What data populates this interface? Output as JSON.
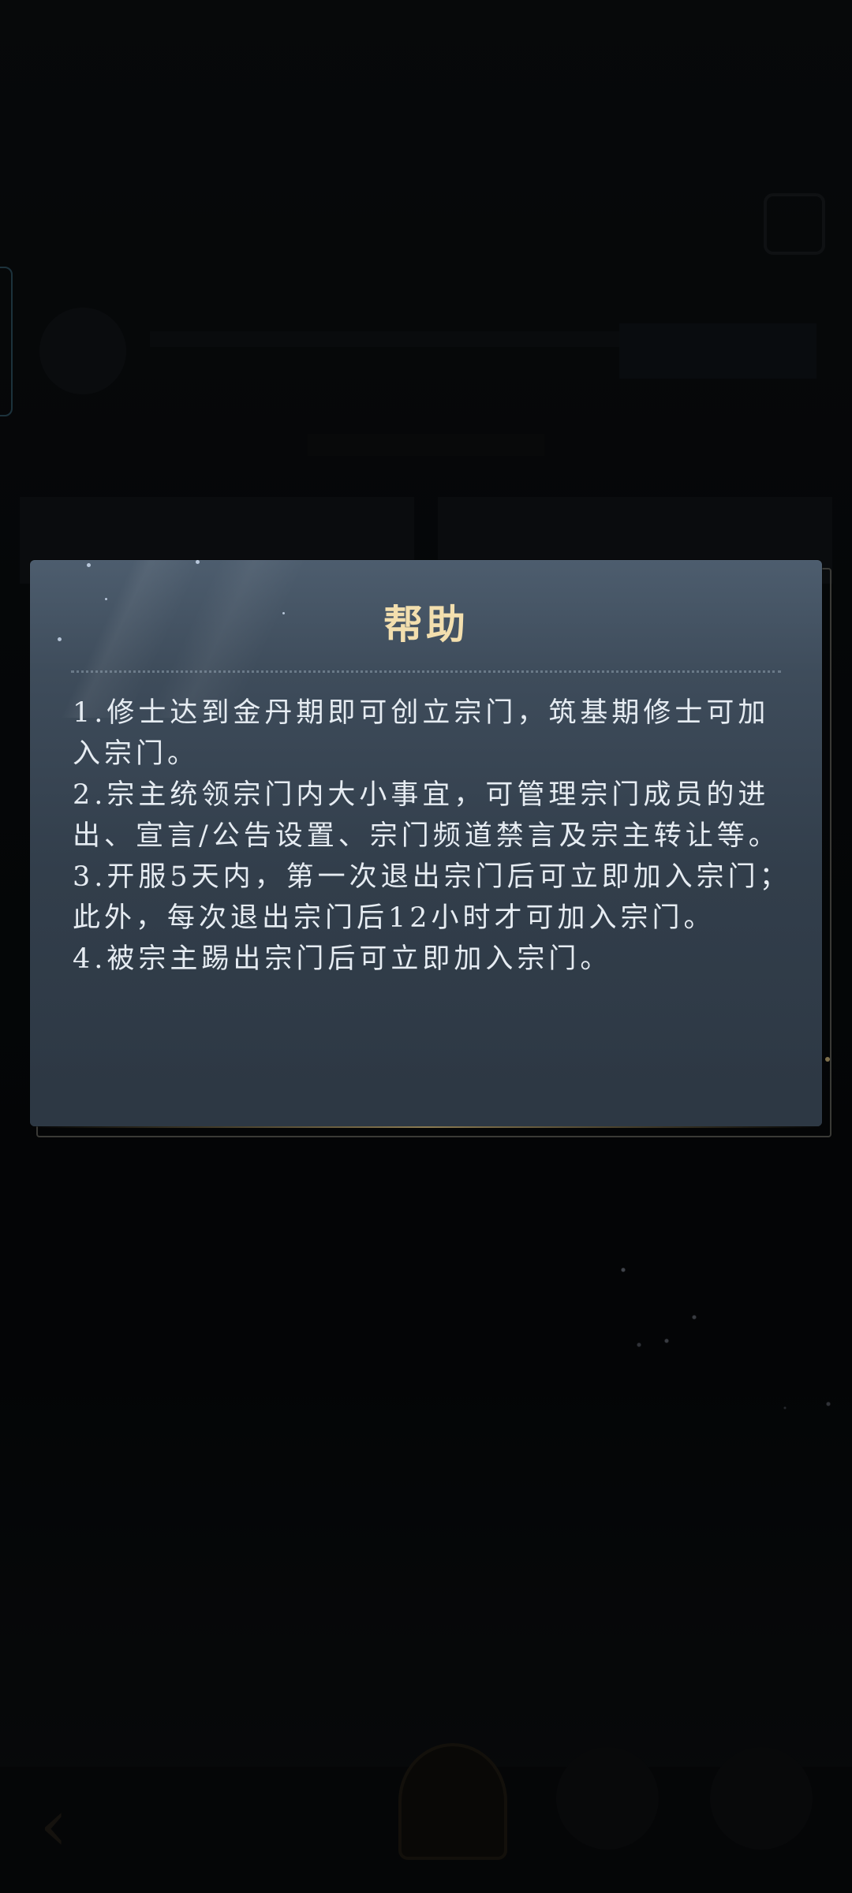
{
  "dialog": {
    "title": "帮助",
    "paragraphs": [
      "1.修士达到金丹期即可创立宗门，筑基期修士可加入宗门。",
      "2.宗主统领宗门内大小事宜，可管理宗门成员的进出、宣言/公告设置、宗门频道禁言及宗主转让等。",
      "3.开服5天内，第一次退出宗门后可立即加入宗门；此外，每次退出宗门后12小时才可加入宗门。",
      "4.被宗主踢出宗门后可立即加入宗门。"
    ]
  },
  "colors": {
    "title": "#f3dfae",
    "body_text": "#e6ecf2",
    "dialog_bg_top": "#4d5d6e",
    "dialog_bg_bottom": "#2d3844",
    "accent_side_tab": "#3f6f86"
  },
  "icons": {
    "back": "back-arrow-icon",
    "home": "home-icon"
  }
}
